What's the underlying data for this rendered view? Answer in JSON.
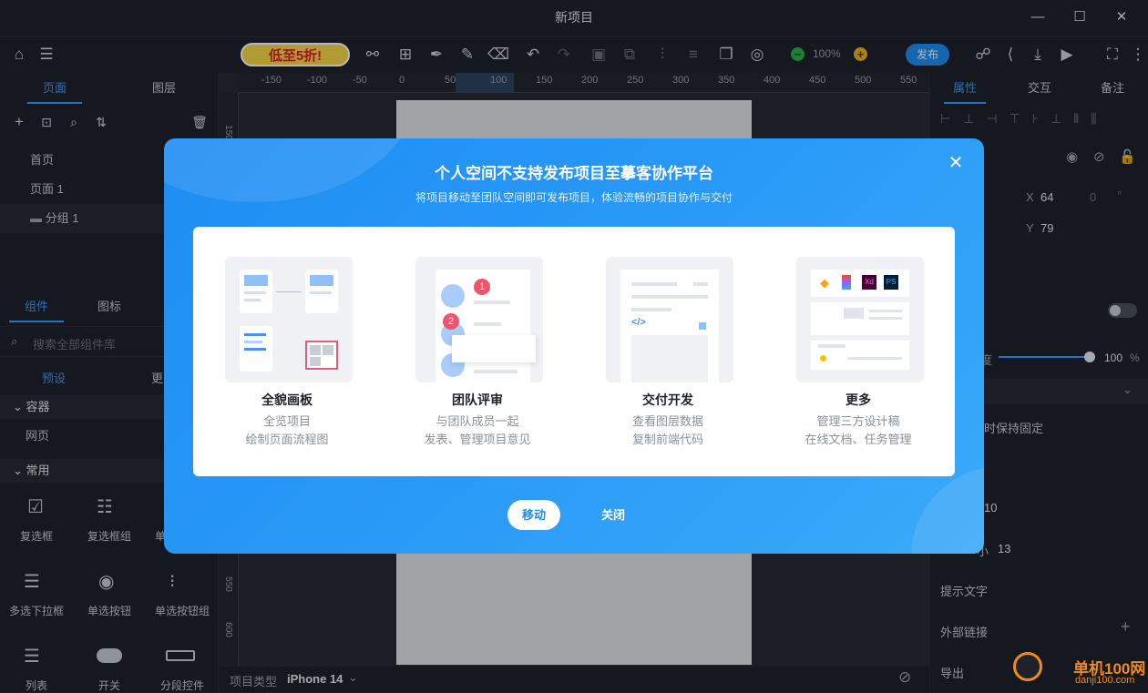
{
  "window": {
    "title": "新项目"
  },
  "toolbar": {
    "banner": "低至5折!",
    "zoom": "100%",
    "publish": "发布"
  },
  "left": {
    "tabs": [
      "页面",
      "图层"
    ],
    "pages": [
      "首页",
      "页面 1",
      "分组 1"
    ],
    "comp_tabs": [
      "组件",
      "图标"
    ],
    "search_placeholder": "搜索全部组件库",
    "preset_tabs": [
      "预设",
      "更"
    ],
    "sections": [
      "容器",
      "常用"
    ],
    "container_item": "网页",
    "widgets": [
      "复选框",
      "复选框组",
      "单",
      "多选下拉框",
      "单选按钮",
      "单选按钮组",
      "列表",
      "开关",
      "分段控件"
    ]
  },
  "ruler": {
    "ticks": [
      "-150",
      "-100",
      "-50",
      "0",
      "50",
      "100",
      "150",
      "200",
      "250",
      "300",
      "350",
      "400",
      "450",
      "500",
      "550"
    ],
    "vticks": [
      "150",
      "550",
      "600"
    ]
  },
  "bottom": {
    "project_type_label": "项目类型",
    "device": "iPhone 14"
  },
  "right": {
    "tabs": [
      "属性",
      "交互",
      "备注"
    ],
    "x_label": "X",
    "x_value": "64",
    "y_label": "Y",
    "y_value": "79",
    "rot_value": "0",
    "rot_unit": "°",
    "opacity_label_fragment": "度",
    "opacity_value": "100",
    "opacity_unit": "%",
    "partial_label1": "时保持固定",
    "partial_value1": "10",
    "partial_label2": "小",
    "partial_value2": "13",
    "hint_text": "提示文字",
    "external_link": "外部链接",
    "export": "导出"
  },
  "modal": {
    "title": "个人空间不支持发布项目至摹客协作平台",
    "subtitle": "将项目移动至团队空间即可发布项目，体验流畅的项目协作与交付",
    "features": [
      {
        "title": "全貌画板",
        "line1": "全览项目",
        "line2": "绘制页面流程图"
      },
      {
        "title": "团队评审",
        "line1": "与团队成员一起",
        "line2": "发表、管理项目意见"
      },
      {
        "title": "交付开发",
        "line1": "查看图层数据",
        "line2": "复制前端代码"
      },
      {
        "title": "更多",
        "line1": "管理三方设计稿",
        "line2": "在线文档、任务管理"
      }
    ],
    "badges": [
      "1",
      "2"
    ],
    "app_icons": [
      "Xd",
      "PS"
    ],
    "move_button": "移动",
    "close_button": "关闭"
  },
  "watermark": {
    "text1": "单机100网",
    "text2": "danji100.com"
  }
}
